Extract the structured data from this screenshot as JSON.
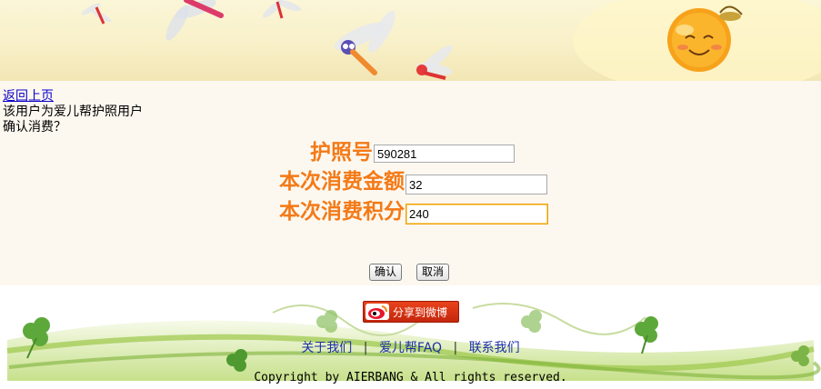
{
  "nav": {
    "back_link": "返回上页"
  },
  "messages": {
    "user_status": "该用户为爱儿帮护照用户",
    "confirm_prompt": "确认消费？"
  },
  "form": {
    "passport": {
      "label": "护照号",
      "value": "590281"
    },
    "amount": {
      "label": "本次消费金额",
      "value": "32"
    },
    "points": {
      "label": "本次消费积分",
      "value": "240"
    }
  },
  "buttons": {
    "confirm": "确认",
    "cancel": "取消"
  },
  "share": {
    "label": "分享到微博",
    "icon": "weibo-icon"
  },
  "footer": {
    "links": {
      "about": "关于我们",
      "faq": "爱儿帮FAQ",
      "contact": "联系我们"
    },
    "separator": "|",
    "copyright": "Copyright by AIERBANG & All rights reserved."
  },
  "colors": {
    "label_orange": "#f47a17",
    "link_blue": "#0b00c8",
    "share_red": "#d8320f"
  }
}
